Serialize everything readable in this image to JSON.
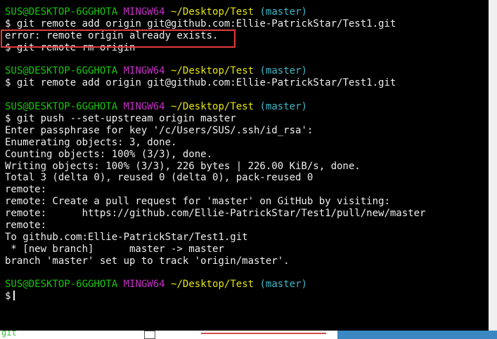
{
  "prompt": {
    "user": "SUS@DESKTOP-6GGHOTA",
    "system": "MINGW64",
    "path": "~/Desktop/Test",
    "branch": "(master)",
    "symbol": "$"
  },
  "commands": {
    "remote_add": "git remote add origin git@github.com:Ellie-PatrickStar/Test1.git",
    "remote_rm": "git remote rm origin",
    "remote_add_again": "git remote add origin git@github.com:Ellie-PatrickStar/Test1.git",
    "push": "git push --set-upstream origin master"
  },
  "error_line": "error: remote origin already exists.",
  "push_output": [
    "Enter passphrase for key '/c/Users/SUS/.ssh/id_rsa':",
    "Enumerating objects: 3, done.",
    "Counting objects: 100% (3/3), done.",
    "Writing objects: 100% (3/3), 226 bytes | 226.00 KiB/s, done.",
    "Total 3 (delta 0), reused 0 (delta 0), pack-reused 0",
    "remote:",
    "remote: Create a pull request for 'master' on GitHub by visiting:",
    "remote:      https://github.com/Ellie-PatrickStar/Test1/pull/new/master",
    "remote:",
    "To github.com:Ellie-PatrickStar/Test1.git",
    " * [new branch]      master -> master",
    "branch 'master' set up to track 'origin/master'."
  ],
  "bottom_strip": {
    "text": "git"
  },
  "colors": {
    "background": "#000000",
    "user": "#16c60c",
    "system": "#c530c5",
    "path": "#e5e510",
    "branch": "#3bb8c8",
    "highlight_box": "#e23b3b"
  }
}
